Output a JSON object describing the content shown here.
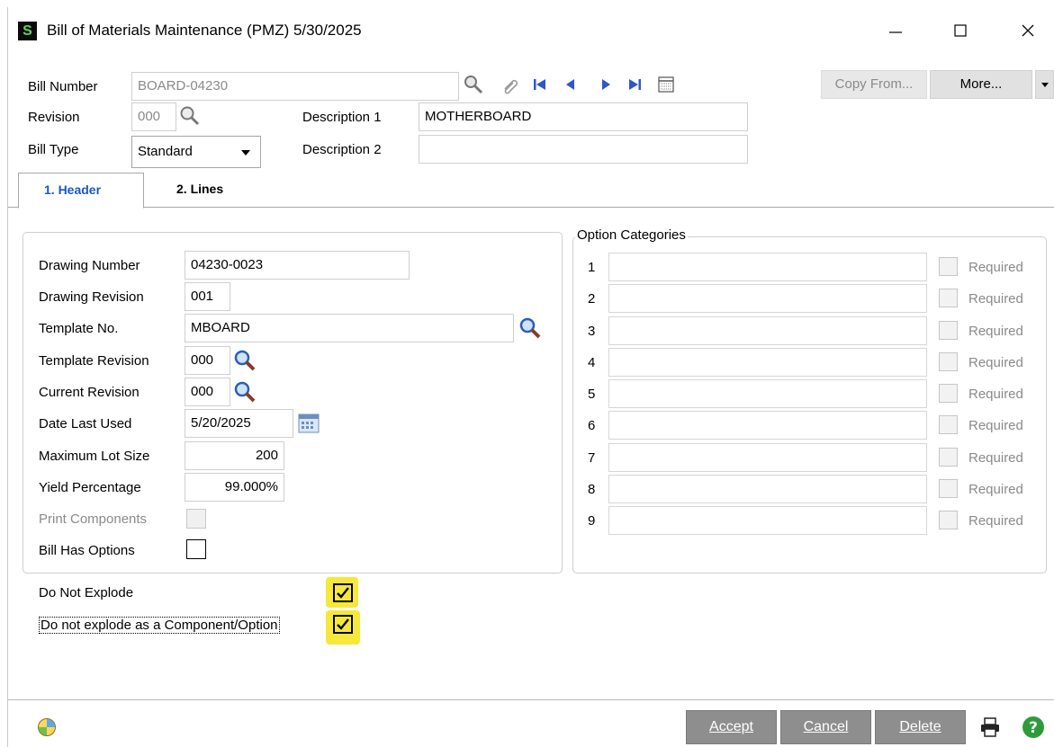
{
  "window": {
    "title": "Bill of Materials Maintenance (PMZ) 5/30/2025",
    "app_icon_letter": "S"
  },
  "header": {
    "bill_number_label": "Bill Number",
    "bill_number_value": "BOARD-04230",
    "revision_label": "Revision",
    "revision_value": "000",
    "bill_type_label": "Bill Type",
    "bill_type_value": "Standard",
    "description1_label": "Description 1",
    "description1_value": "MOTHERBOARD",
    "description2_label": "Description 2",
    "description2_value": "",
    "copy_from_label": "Copy From...",
    "more_label": "More..."
  },
  "tabs": [
    {
      "label": "1. Header",
      "active": true
    },
    {
      "label": "2. Lines",
      "active": false
    }
  ],
  "form": {
    "drawing_number_label": "Drawing Number",
    "drawing_number_value": "04230-0023",
    "drawing_revision_label": "Drawing Revision",
    "drawing_revision_value": "001",
    "template_no_label": "Template No.",
    "template_no_value": "MBOARD",
    "template_revision_label": "Template Revision",
    "template_revision_value": "000",
    "current_revision_label": "Current Revision",
    "current_revision_value": "000",
    "date_last_used_label": "Date Last Used",
    "date_last_used_value": "5/20/2025",
    "max_lot_size_label": "Maximum Lot Size",
    "max_lot_size_value": "200",
    "yield_pct_label": "Yield Percentage",
    "yield_pct_value": "99.000%",
    "print_components_label": "Print Components",
    "bill_has_options_label": "Bill Has Options",
    "do_not_explode_label": "Do Not Explode",
    "do_not_explode_checked": true,
    "do_not_explode_component_label": "Do not explode as a Component/Option",
    "do_not_explode_component_checked": true
  },
  "option_categories": {
    "title": "Option Categories",
    "required_label": "Required",
    "rows": [
      "1",
      "2",
      "3",
      "4",
      "5",
      "6",
      "7",
      "8",
      "9"
    ]
  },
  "footer": {
    "accept_label": "Accept",
    "cancel_label": "Cancel",
    "delete_label": "Delete"
  },
  "colors": {
    "highlight": "#f5e83a",
    "tab_active": "#1a56c4",
    "footer_button": "#8e8e8e"
  }
}
